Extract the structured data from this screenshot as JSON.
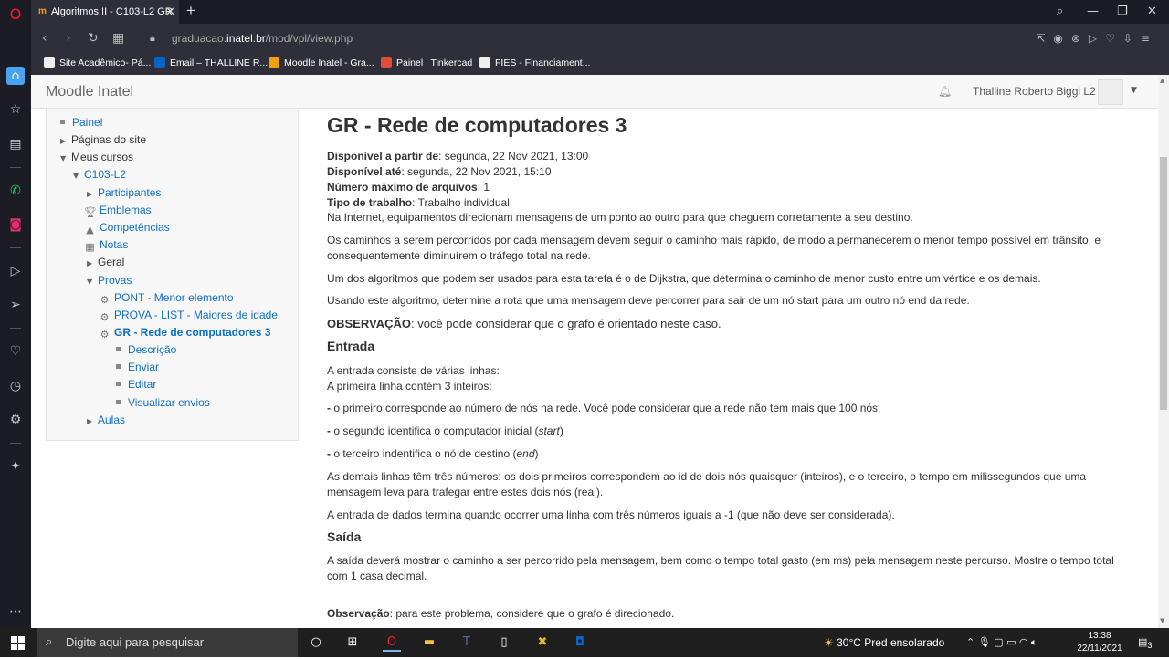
{
  "browser": {
    "tab_title": "Algoritmos II - C103-L2 GR",
    "url_domain": "graduacao.",
    "url_host": "inatel.br",
    "url_path": "/mod/vpl/view.php",
    "bookmarks": [
      "Site Acadêmico- Pá...",
      "Email – THALLINE R...",
      "Moodle Inatel - Gra...",
      "Painel | Tinkercad",
      "FIES - Financiament..."
    ]
  },
  "navbar": {
    "brand": "Moodle Inatel",
    "user_name": "Thalline Roberto Biggi L2"
  },
  "nav_tree": {
    "painel": "Painel",
    "paginas": "Páginas do site",
    "meus_cursos": "Meus cursos",
    "curso": "C103-L2",
    "participantes": "Participantes",
    "emblemas": "Emblemas",
    "competencias": "Competências",
    "notas": "Notas",
    "geral": "Geral",
    "provas": "Provas",
    "pont": "PONT - Menor elemento",
    "prova_list": "PROVA - LIST - Maiores de idade",
    "gr": "GR - Rede de computadores 3",
    "descricao": "Descrição",
    "enviar": "Enviar",
    "editar": "Editar",
    "visualizar": "Visualizar envios",
    "aulas": "Aulas"
  },
  "main": {
    "title": "GR - Rede de computadores 3",
    "disp_de_label": "Disponível a partir de",
    "disp_de_value": ": segunda, 22 Nov 2021, 13:00",
    "disp_ate_label": "Disponível até",
    "disp_ate_value": ": segunda, 22 Nov 2021, 15:10",
    "max_arq_label": "Número máximo de arquivos",
    "max_arq_value": ": 1",
    "tipo_label": "Tipo de trabalho",
    "tipo_value": ": Trabalho individual",
    "p1": "Na Internet, equipamentos direcionam mensagens de um ponto ao outro para que cheguem corretamente a seu destino.",
    "p2": "Os caminhos a serem percorridos por cada mensagem devem seguir o caminho mais rápido, de modo a permanecerem o menor tempo possível em trânsito, e consequentemente diminuírem o tráfego total na rede.",
    "p3": "Um dos algoritmos que podem ser usados para esta tarefa é o de Dijkstra, que determina o caminho de menor custo entre um vértice e os demais.",
    "p4": "Usando este algoritmo, determine a rota que uma mensagem deve percorrer para sair de um nó start para um outro nó end da rede.",
    "obs_label": "OBSERVAÇÃO",
    "obs_text": ": você pode considerar que o grafo é orientado neste caso.",
    "entrada_h": "Entrada",
    "e1": "A entrada consiste de várias linhas:",
    "e2": "A primeira linha contém 3 inteiros:",
    "e3_dash": "-",
    "e3": " o primeiro corresponde ao número de nós na rede. Você pode considerar que a rede não tem mais que 100 nós.",
    "e4_a": " o segundo identifica o computador inicial (",
    "e4_em": "start",
    "e4_b": ")",
    "e5_a": " o terceiro indentifica o nó de destino (",
    "e5_em": "end",
    "e5_b": ")",
    "e6": "As demais linhas têm três números: os dois primeiros correspondem ao id de dois nós quaisquer (inteiros), e o terceiro, o tempo em milissegundos que uma mensagem leva para trafegar entre estes dois nós (real).",
    "e7": "A entrada de dados termina quando ocorrer uma linha com três números iguais a -1 (que não deve ser considerada).",
    "saida_h": "Saída",
    "s1": "A saída deverá mostrar o caminho a ser percorrido pela mensagem, bem como o tempo total gasto (em ms) pela mensagem neste percurso. Mostre o tempo total com 1 casa decimal.",
    "obs2_label": "Observação",
    "obs2_text": ": para este problema, considere que o grafo é direcionado."
  },
  "taskbar": {
    "search_placeholder": "Digite aqui para pesquisar",
    "weather": "30°C  Pred ensolarado",
    "time": "13:38",
    "date": "22/11/2021",
    "notif_count": "3"
  }
}
